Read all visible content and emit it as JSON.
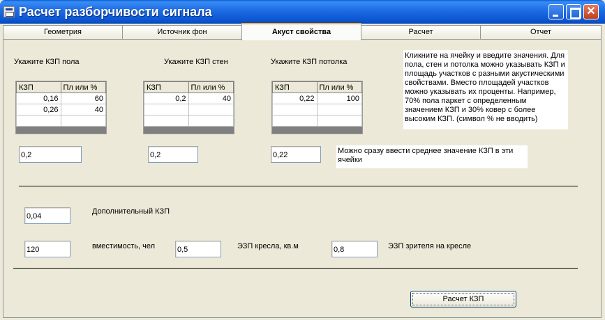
{
  "window": {
    "title": "Расчет разборчивости сигнала"
  },
  "tabs": [
    "Геометрия",
    "Источник фон",
    "Акуст свойства",
    "Расчет",
    "Отчет"
  ],
  "active_tab": "Акуст свойства",
  "floor": {
    "label": "Укажите КЗП пола",
    "headers": [
      "КЗП",
      "Пл или %"
    ],
    "rows": [
      [
        "0,16",
        "60"
      ],
      [
        "0,26",
        "40"
      ],
      [
        "",
        ""
      ]
    ],
    "average": "0,2"
  },
  "walls": {
    "label": "Укажите КЗП стен",
    "headers": [
      "КЗП",
      "Пл или %"
    ],
    "rows": [
      [
        "0,2",
        "40"
      ],
      [
        "",
        ""
      ],
      [
        "",
        ""
      ]
    ],
    "average": "0,2"
  },
  "ceiling": {
    "label": "Укажите КЗП потолка",
    "headers": [
      "КЗП",
      "Пл или %"
    ],
    "rows": [
      [
        "0,22",
        "100"
      ],
      [
        "",
        ""
      ],
      [
        "",
        ""
      ]
    ],
    "average": "0,22"
  },
  "help_note": "Кликните на ячейку и введите значения. Для пола, стен и потолка можно указывать КЗП и площадь участков с разными акустическими свойствами. Вместо площадей участков можно указывать их проценты. Например, 70% пола паркет с определенным значением КЗП и 30% ковер с более высоким КЗП. (символ % не вводить)",
  "average_note": "Можно сразу ввести среднее значение КЗП в эти ячейки",
  "extra": {
    "label": "Дополнительный КЗП",
    "value": "0,04"
  },
  "capacity": {
    "label": "вместимость, чел",
    "value": "120"
  },
  "seat": {
    "label": "ЭЗП кресла, кв.м",
    "value": "0,5"
  },
  "viewer": {
    "label": "ЭЗП зрителя на кресле",
    "value": "0,8"
  },
  "calc_button": "Расчет КЗП"
}
